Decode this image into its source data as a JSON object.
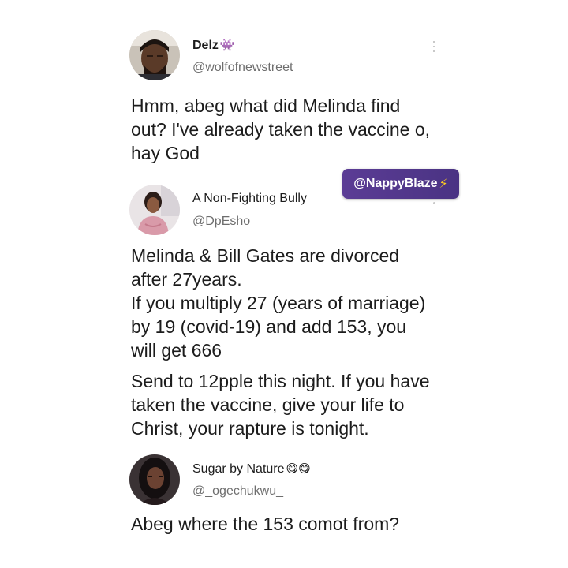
{
  "tweets": [
    {
      "name": "Delz",
      "name_emoji": "👾",
      "handle": "@wolfofnewstreet",
      "text": "Hmm, abeg what did Melinda find\nout? I've already taken the vaccine o,\nhay God"
    },
    {
      "name": "A Non-Fighting Bully",
      "handle": "@DpEsho",
      "text": "Melinda & Bill Gates are divorced\nafter 27years.\nIf you multiply 27 (years of marriage)\nby 19 (covid-19) and add 153, you\nwill get 666",
      "text2": "Send to 12pple this night. If you have\ntaken the vaccine, give your life to\nChrist, your rapture is tonight."
    },
    {
      "name": "Sugar by Nature",
      "name_emoji": "😋😋",
      "handle": "@_ogechukwu_",
      "text": "Abeg where the 153 comot from?"
    }
  ],
  "watermark": {
    "text": "@NappyBlaze",
    "icon": "lightning-bolt-icon",
    "glyph": "⚡"
  },
  "colors": {
    "watermark_bg": "#5b3c95",
    "handle": "#6e6e6e",
    "text": "#1c1c1c"
  }
}
